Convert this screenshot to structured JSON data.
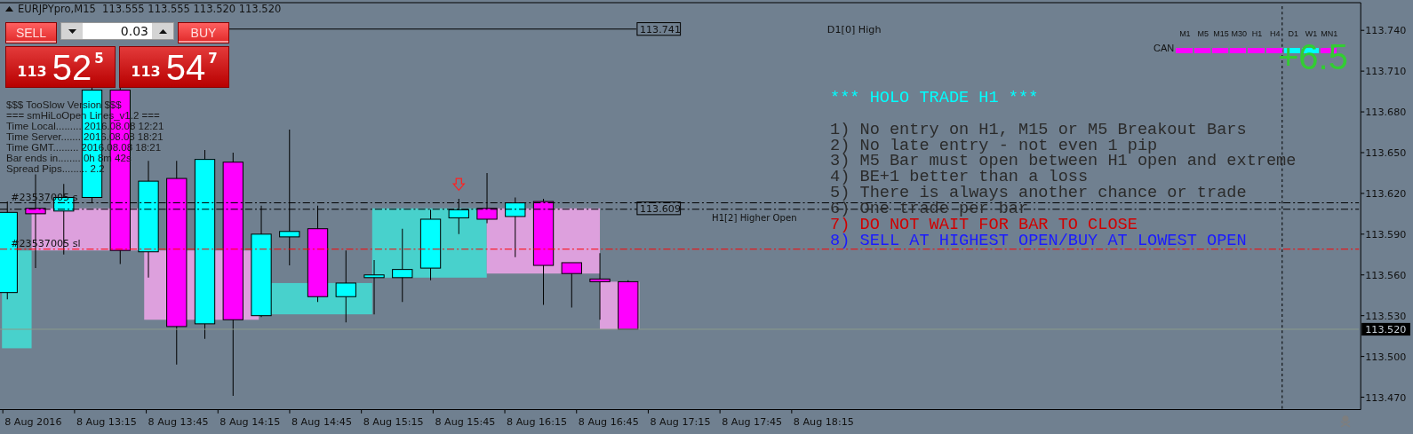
{
  "window": {
    "symbol_line": "EURJPYpro,M15  113.555 113.555 113.520 113.520"
  },
  "trade_panel": {
    "sell": {
      "label": "SELL",
      "price_prefix": "113",
      "price_main": "52",
      "price_pip": "5"
    },
    "buy": {
      "label": "BUY",
      "price_prefix": "113",
      "price_main": "54",
      "price_pip": "7"
    },
    "lot": "0.03"
  },
  "info_lines": [
    "$$$ TooSlow Version $$$",
    "=== smHiLoOpen Lines_v1.2 ===",
    "Time Local......... 2016.08.08 12:21",
    "Time Server....... 2016.08.08 18:21",
    "Time GMT......... 2016.08.08 18:21",
    "Bar ends in........ 0h 8m 42s",
    "Spread Pips......... 2.2"
  ],
  "rules": {
    "title": "*** HOLO TRADE H1 ***",
    "items": [
      {
        "text": "1) No entry on H1, M15 or M5 Breakout Bars",
        "color": "#2b2b2b"
      },
      {
        "text": "2) No late entry - not even 1 pip",
        "color": "#2b2b2b"
      },
      {
        "text": "3) M5 Bar must open between H1 open and extreme",
        "color": "#2b2b2b"
      },
      {
        "text": "4) BE+1 better than a loss",
        "color": "#2b2b2b"
      },
      {
        "text": "5) There is always another chance or trade",
        "color": "#2b2b2b"
      },
      {
        "text": "6) One trade per bar",
        "color": "#2b2b2b"
      },
      {
        "text": "7) DO NOT WAIT FOR BAR TO CLOSE",
        "color": "#d00000"
      },
      {
        "text": "8) SELL AT HIGHEST OPEN/BUY AT LOWEST OPEN",
        "color": "#1a1aff"
      }
    ]
  },
  "timeframes": {
    "row_label": "CAN",
    "score": "+6.5",
    "items": [
      {
        "label": "M1",
        "color": "#ff00ff"
      },
      {
        "label": "M5",
        "color": "#ff00ff"
      },
      {
        "label": "M15",
        "color": "#ff00ff"
      },
      {
        "label": "M30",
        "color": "#ff00ff"
      },
      {
        "label": "H1",
        "color": "#ff00ff"
      },
      {
        "label": "H4",
        "color": "#ff00ff"
      },
      {
        "label": "D1",
        "color": "#00ffff"
      },
      {
        "label": "W1",
        "color": "#00ffff"
      },
      {
        "label": "MN1",
        "color": "#ff00ff"
      }
    ]
  },
  "chart": {
    "price_axis": [
      "113.740",
      "113.710",
      "113.680",
      "113.650",
      "113.620",
      "113.590",
      "113.560",
      "113.530",
      "113.500",
      "113.470"
    ],
    "time_axis": [
      "8 Aug 2016",
      "8 Aug 13:15",
      "8 Aug 13:45",
      "8 Aug 14:15",
      "8 Aug 14:45",
      "8 Aug 15:15",
      "8 Aug 15:45",
      "8 Aug 16:15",
      "8 Aug 16:45",
      "8 Aug 17:15",
      "8 Aug 17:45",
      "8 Aug 18:15"
    ],
    "price_tags": [
      {
        "label": "113.741",
        "note": "D1[0] High"
      },
      {
        "label": "113.609",
        "note": "H1[2] Higher Open"
      }
    ],
    "order_labels": [
      "#23537005 s",
      "#23537005 sl"
    ],
    "current_price": "113.520"
  }
}
